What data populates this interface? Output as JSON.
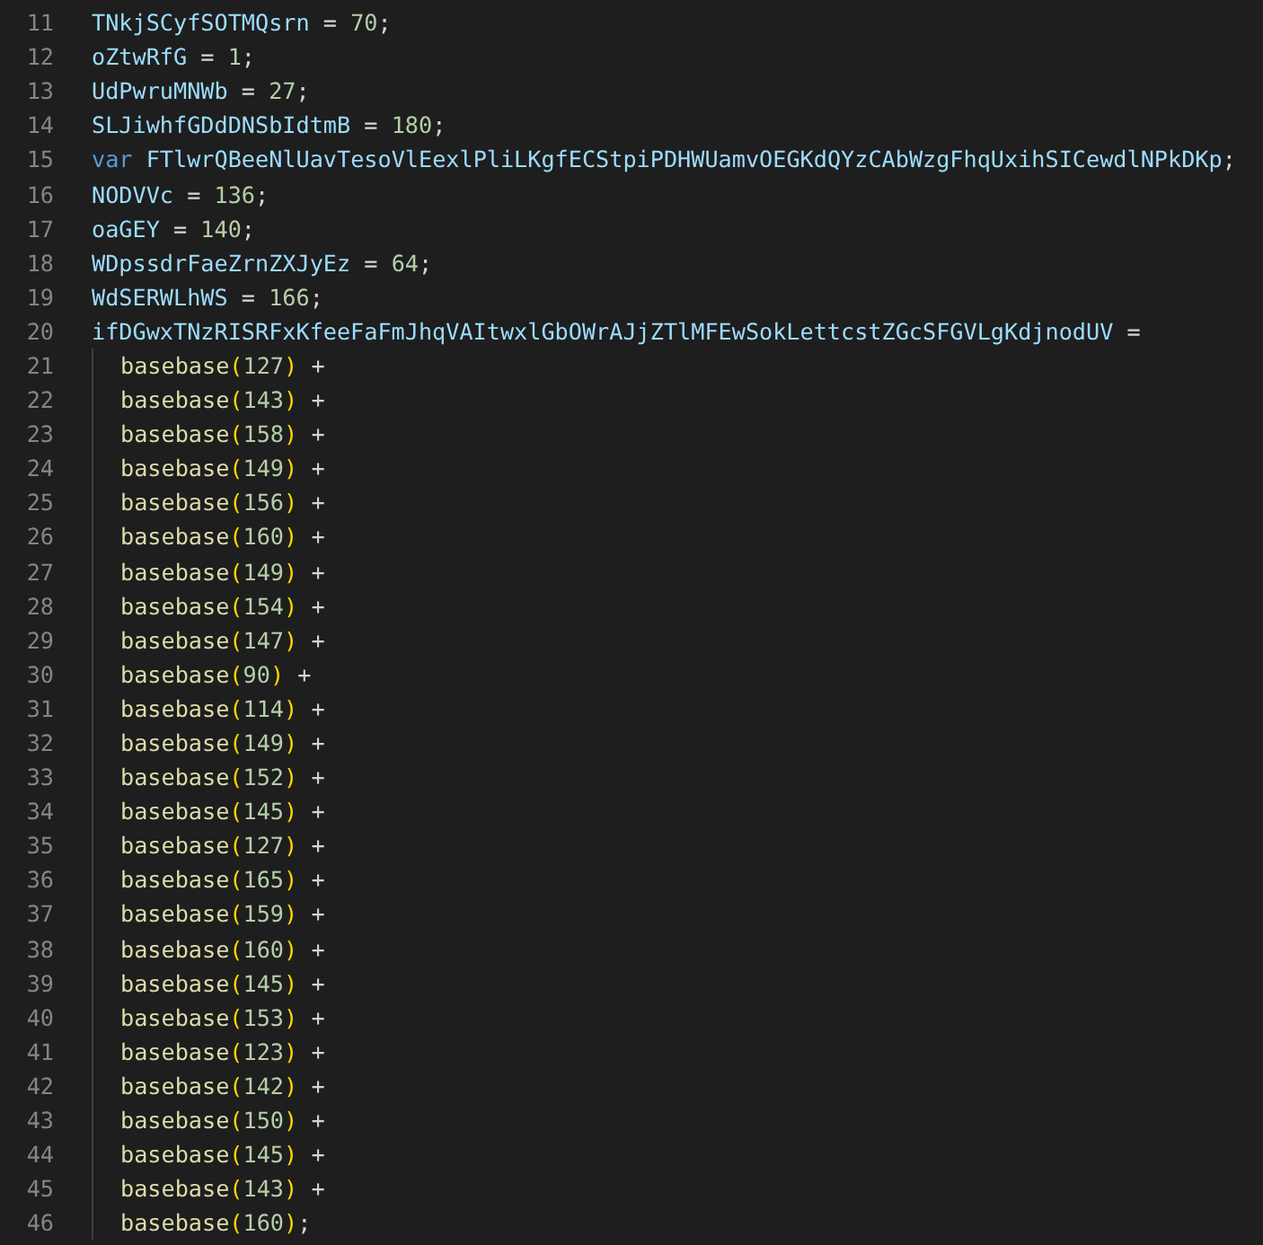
{
  "editor": {
    "lines": [
      {
        "number": "11",
        "tokens": [
          {
            "kind": "ident",
            "text": "TNkjSCyfSOTMQsrn"
          },
          {
            "kind": "op",
            "text": " = "
          },
          {
            "kind": "num",
            "text": "70"
          },
          {
            "kind": "op",
            "text": ";"
          }
        ]
      },
      {
        "number": "12",
        "tokens": [
          {
            "kind": "ident",
            "text": "oZtwRfG"
          },
          {
            "kind": "op",
            "text": " = "
          },
          {
            "kind": "num",
            "text": "1"
          },
          {
            "kind": "op",
            "text": ";"
          }
        ]
      },
      {
        "number": "13",
        "tokens": [
          {
            "kind": "ident",
            "text": "UdPwruMNWb"
          },
          {
            "kind": "op",
            "text": " = "
          },
          {
            "kind": "num",
            "text": "27"
          },
          {
            "kind": "op",
            "text": ";"
          }
        ]
      },
      {
        "number": "14",
        "tokens": [
          {
            "kind": "ident",
            "text": "SLJiwhfGDdDNSbIdtmB"
          },
          {
            "kind": "op",
            "text": " = "
          },
          {
            "kind": "num",
            "text": "180"
          },
          {
            "kind": "op",
            "text": ";"
          }
        ]
      },
      {
        "number": "15",
        "tokens": [
          {
            "kind": "kw",
            "text": "var "
          },
          {
            "kind": "ident",
            "text": "FTlwrQBeeNlUavTesoVlEexlPliLKgfECStpiPDHWUamvOEGKdQYzCAbWzgFhqUxihSICewdlNPkDKp"
          },
          {
            "kind": "op",
            "text": ";"
          }
        ]
      },
      {
        "number": "16",
        "tokens": [
          {
            "kind": "ident",
            "text": "NODVVc"
          },
          {
            "kind": "op",
            "text": " = "
          },
          {
            "kind": "num",
            "text": "136"
          },
          {
            "kind": "op",
            "text": ";"
          }
        ]
      },
      {
        "number": "17",
        "tokens": [
          {
            "kind": "ident",
            "text": "oaGEY"
          },
          {
            "kind": "op",
            "text": " = "
          },
          {
            "kind": "num",
            "text": "140"
          },
          {
            "kind": "op",
            "text": ";"
          }
        ]
      },
      {
        "number": "18",
        "tokens": [
          {
            "kind": "ident",
            "text": "WDpssdrFaeZrnZXJyEz"
          },
          {
            "kind": "op",
            "text": " = "
          },
          {
            "kind": "num",
            "text": "64"
          },
          {
            "kind": "op",
            "text": ";"
          }
        ]
      },
      {
        "number": "19",
        "tokens": [
          {
            "kind": "ident",
            "text": "WdSERWLhWS"
          },
          {
            "kind": "op",
            "text": " = "
          },
          {
            "kind": "num",
            "text": "166"
          },
          {
            "kind": "op",
            "text": ";"
          }
        ]
      },
      {
        "number": "20",
        "tokens": [
          {
            "kind": "ident",
            "text": "ifDGwxTNzRISRFxKfeeFaFmJhqVAItwxlGbOWrAJjZTlMFEwSokLettcstZGcSFGVLgKdjnodUV"
          },
          {
            "kind": "op",
            "text": " ="
          }
        ],
        "children": [
          {
            "number": "21",
            "tokens": [
              {
                "kind": "func",
                "text": "basebase"
              },
              {
                "kind": "paren",
                "text": "("
              },
              {
                "kind": "num",
                "text": "127"
              },
              {
                "kind": "paren",
                "text": ")"
              },
              {
                "kind": "op",
                "text": " +"
              }
            ]
          },
          {
            "number": "22",
            "tokens": [
              {
                "kind": "func",
                "text": "basebase"
              },
              {
                "kind": "paren",
                "text": "("
              },
              {
                "kind": "num",
                "text": "143"
              },
              {
                "kind": "paren",
                "text": ")"
              },
              {
                "kind": "op",
                "text": " +"
              }
            ]
          },
          {
            "number": "23",
            "tokens": [
              {
                "kind": "func",
                "text": "basebase"
              },
              {
                "kind": "paren",
                "text": "("
              },
              {
                "kind": "num",
                "text": "158"
              },
              {
                "kind": "paren",
                "text": ")"
              },
              {
                "kind": "op",
                "text": " +"
              }
            ]
          },
          {
            "number": "24",
            "tokens": [
              {
                "kind": "func",
                "text": "basebase"
              },
              {
                "kind": "paren",
                "text": "("
              },
              {
                "kind": "num",
                "text": "149"
              },
              {
                "kind": "paren",
                "text": ")"
              },
              {
                "kind": "op",
                "text": " +"
              }
            ]
          },
          {
            "number": "25",
            "tokens": [
              {
                "kind": "func",
                "text": "basebase"
              },
              {
                "kind": "paren",
                "text": "("
              },
              {
                "kind": "num",
                "text": "156"
              },
              {
                "kind": "paren",
                "text": ")"
              },
              {
                "kind": "op",
                "text": " +"
              }
            ]
          },
          {
            "number": "26",
            "tokens": [
              {
                "kind": "func",
                "text": "basebase"
              },
              {
                "kind": "paren",
                "text": "("
              },
              {
                "kind": "num",
                "text": "160"
              },
              {
                "kind": "paren",
                "text": ")"
              },
              {
                "kind": "op",
                "text": " +"
              }
            ]
          },
          {
            "number": "27",
            "tokens": [
              {
                "kind": "func",
                "text": "basebase"
              },
              {
                "kind": "paren",
                "text": "("
              },
              {
                "kind": "num",
                "text": "149"
              },
              {
                "kind": "paren",
                "text": ")"
              },
              {
                "kind": "op",
                "text": " +"
              }
            ]
          },
          {
            "number": "28",
            "tokens": [
              {
                "kind": "func",
                "text": "basebase"
              },
              {
                "kind": "paren",
                "text": "("
              },
              {
                "kind": "num",
                "text": "154"
              },
              {
                "kind": "paren",
                "text": ")"
              },
              {
                "kind": "op",
                "text": " +"
              }
            ]
          },
          {
            "number": "29",
            "tokens": [
              {
                "kind": "func",
                "text": "basebase"
              },
              {
                "kind": "paren",
                "text": "("
              },
              {
                "kind": "num",
                "text": "147"
              },
              {
                "kind": "paren",
                "text": ")"
              },
              {
                "kind": "op",
                "text": " +"
              }
            ]
          },
          {
            "number": "30",
            "tokens": [
              {
                "kind": "func",
                "text": "basebase"
              },
              {
                "kind": "paren",
                "text": "("
              },
              {
                "kind": "num",
                "text": "90"
              },
              {
                "kind": "paren",
                "text": ")"
              },
              {
                "kind": "op",
                "text": " +"
              }
            ]
          },
          {
            "number": "31",
            "tokens": [
              {
                "kind": "func",
                "text": "basebase"
              },
              {
                "kind": "paren",
                "text": "("
              },
              {
                "kind": "num",
                "text": "114"
              },
              {
                "kind": "paren",
                "text": ")"
              },
              {
                "kind": "op",
                "text": " +"
              }
            ]
          },
          {
            "number": "32",
            "tokens": [
              {
                "kind": "func",
                "text": "basebase"
              },
              {
                "kind": "paren",
                "text": "("
              },
              {
                "kind": "num",
                "text": "149"
              },
              {
                "kind": "paren",
                "text": ")"
              },
              {
                "kind": "op",
                "text": " +"
              }
            ]
          },
          {
            "number": "33",
            "tokens": [
              {
                "kind": "func",
                "text": "basebase"
              },
              {
                "kind": "paren",
                "text": "("
              },
              {
                "kind": "num",
                "text": "152"
              },
              {
                "kind": "paren",
                "text": ")"
              },
              {
                "kind": "op",
                "text": " +"
              }
            ]
          },
          {
            "number": "34",
            "tokens": [
              {
                "kind": "func",
                "text": "basebase"
              },
              {
                "kind": "paren",
                "text": "("
              },
              {
                "kind": "num",
                "text": "145"
              },
              {
                "kind": "paren",
                "text": ")"
              },
              {
                "kind": "op",
                "text": " +"
              }
            ]
          },
          {
            "number": "35",
            "tokens": [
              {
                "kind": "func",
                "text": "basebase"
              },
              {
                "kind": "paren",
                "text": "("
              },
              {
                "kind": "num",
                "text": "127"
              },
              {
                "kind": "paren",
                "text": ")"
              },
              {
                "kind": "op",
                "text": " +"
              }
            ]
          },
          {
            "number": "36",
            "tokens": [
              {
                "kind": "func",
                "text": "basebase"
              },
              {
                "kind": "paren",
                "text": "("
              },
              {
                "kind": "num",
                "text": "165"
              },
              {
                "kind": "paren",
                "text": ")"
              },
              {
                "kind": "op",
                "text": " +"
              }
            ]
          },
          {
            "number": "37",
            "tokens": [
              {
                "kind": "func",
                "text": "basebase"
              },
              {
                "kind": "paren",
                "text": "("
              },
              {
                "kind": "num",
                "text": "159"
              },
              {
                "kind": "paren",
                "text": ")"
              },
              {
                "kind": "op",
                "text": " +"
              }
            ]
          },
          {
            "number": "38",
            "tokens": [
              {
                "kind": "func",
                "text": "basebase"
              },
              {
                "kind": "paren",
                "text": "("
              },
              {
                "kind": "num",
                "text": "160"
              },
              {
                "kind": "paren",
                "text": ")"
              },
              {
                "kind": "op",
                "text": " +"
              }
            ]
          },
          {
            "number": "39",
            "tokens": [
              {
                "kind": "func",
                "text": "basebase"
              },
              {
                "kind": "paren",
                "text": "("
              },
              {
                "kind": "num",
                "text": "145"
              },
              {
                "kind": "paren",
                "text": ")"
              },
              {
                "kind": "op",
                "text": " +"
              }
            ]
          },
          {
            "number": "40",
            "tokens": [
              {
                "kind": "func",
                "text": "basebase"
              },
              {
                "kind": "paren",
                "text": "("
              },
              {
                "kind": "num",
                "text": "153"
              },
              {
                "kind": "paren",
                "text": ")"
              },
              {
                "kind": "op",
                "text": " +"
              }
            ]
          },
          {
            "number": "41",
            "tokens": [
              {
                "kind": "func",
                "text": "basebase"
              },
              {
                "kind": "paren",
                "text": "("
              },
              {
                "kind": "num",
                "text": "123"
              },
              {
                "kind": "paren",
                "text": ")"
              },
              {
                "kind": "op",
                "text": " +"
              }
            ]
          },
          {
            "number": "42",
            "tokens": [
              {
                "kind": "func",
                "text": "basebase"
              },
              {
                "kind": "paren",
                "text": "("
              },
              {
                "kind": "num",
                "text": "142"
              },
              {
                "kind": "paren",
                "text": ")"
              },
              {
                "kind": "op",
                "text": " +"
              }
            ]
          },
          {
            "number": "43",
            "tokens": [
              {
                "kind": "func",
                "text": "basebase"
              },
              {
                "kind": "paren",
                "text": "("
              },
              {
                "kind": "num",
                "text": "150"
              },
              {
                "kind": "paren",
                "text": ")"
              },
              {
                "kind": "op",
                "text": " +"
              }
            ]
          },
          {
            "number": "44",
            "tokens": [
              {
                "kind": "func",
                "text": "basebase"
              },
              {
                "kind": "paren",
                "text": "("
              },
              {
                "kind": "num",
                "text": "145"
              },
              {
                "kind": "paren",
                "text": ")"
              },
              {
                "kind": "op",
                "text": " +"
              }
            ]
          },
          {
            "number": "45",
            "tokens": [
              {
                "kind": "func",
                "text": "basebase"
              },
              {
                "kind": "paren",
                "text": "("
              },
              {
                "kind": "num",
                "text": "143"
              },
              {
                "kind": "paren",
                "text": ")"
              },
              {
                "kind": "op",
                "text": " +"
              }
            ]
          },
          {
            "number": "46",
            "tokens": [
              {
                "kind": "func",
                "text": "basebase"
              },
              {
                "kind": "paren",
                "text": "("
              },
              {
                "kind": "num",
                "text": "160"
              },
              {
                "kind": "paren",
                "text": ")"
              },
              {
                "kind": "op",
                "text": ";"
              }
            ]
          }
        ]
      }
    ]
  }
}
